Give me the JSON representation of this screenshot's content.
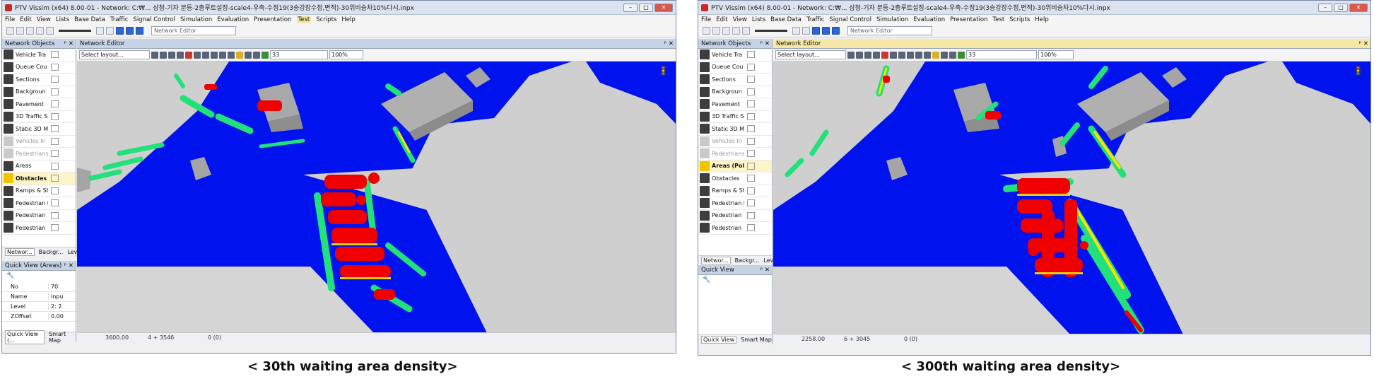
{
  "left_window": {
    "title": "PTV Vissim (x64) 8.00-01 - Network: C:₩... 상청-기자 분등-2층루트설정-scale4-우측-수정19(3승강장수정,면적)-30위비승차10%다시.inpx",
    "menu": [
      "File",
      "Edit",
      "View",
      "Lists",
      "Base Data",
      "Traffic",
      "Signal Control",
      "Simulation",
      "Evaluation",
      "Presentation",
      "Test",
      "Scripts",
      "Help"
    ],
    "network_editor_combo": "Network Editor",
    "network_objects_title": "Network Objects",
    "network_objects": [
      {
        "label": "Vehicle Tra",
        "state": "normal"
      },
      {
        "label": "Queue Cou",
        "state": "normal"
      },
      {
        "label": "Sections",
        "state": "normal"
      },
      {
        "label": "Backgroun",
        "state": "normal"
      },
      {
        "label": "Pavement",
        "state": "normal"
      },
      {
        "label": "3D Traffic S",
        "state": "normal"
      },
      {
        "label": "Static 3D M",
        "state": "normal"
      },
      {
        "label": "Vehicles In",
        "state": "dim"
      },
      {
        "label": "Pedestrians",
        "state": "dim"
      },
      {
        "label": "Areas",
        "state": "normal"
      },
      {
        "label": "Obstacles (",
        "state": "selected"
      },
      {
        "label": "Ramps & St",
        "state": "normal"
      },
      {
        "label": "Pedestrian I",
        "state": "normal"
      },
      {
        "label": "Pedestrian",
        "state": "normal"
      },
      {
        "label": "Pedestrian",
        "state": "normal"
      }
    ],
    "panel_tabs": [
      "Networ...",
      "Backgr...",
      "Levels"
    ],
    "quick_view_title": "Quick View (Areas)",
    "quick_view_rows": [
      {
        "key": "No",
        "value": "70"
      },
      {
        "key": "Name",
        "value": "inpu"
      },
      {
        "key": "Level",
        "value": "2: 2"
      },
      {
        "key": "ZOffset",
        "value": "0.00"
      }
    ],
    "quick_view_tabs": [
      "Quick View (...",
      "Smart Map"
    ],
    "editor_title": "Network Editor",
    "layout_placeholder": "Select layout...",
    "layout_value": "33",
    "zoom": "100%",
    "status": {
      "time": "3600.00",
      "coord": "4 + 3546",
      "count": "0 (0)"
    },
    "caption": "< 30th waiting area density>"
  },
  "right_window": {
    "title": "PTV Vissim (x64) 8.00-01 - Network: C:₩... 상청-기자 분등-2층루트설정-scale4-우측-수정19(3승강장수정,면적)-30위비승차10%다시.inpx",
    "menu": [
      "File",
      "Edit",
      "View",
      "Lists",
      "Base Data",
      "Traffic",
      "Signal Control",
      "Simulation",
      "Evaluation",
      "Presentation",
      "Test",
      "Scripts",
      "Help"
    ],
    "network_editor_combo": "Network Editor",
    "network_objects_title": "Network Objects",
    "network_objects": [
      {
        "label": "Vehicle Tra",
        "state": "normal"
      },
      {
        "label": "Queue Cou",
        "state": "normal"
      },
      {
        "label": "Sections",
        "state": "normal"
      },
      {
        "label": "Backgroun",
        "state": "normal"
      },
      {
        "label": "Pavement",
        "state": "normal"
      },
      {
        "label": "3D Traffic S",
        "state": "normal"
      },
      {
        "label": "Static 3D M",
        "state": "normal"
      },
      {
        "label": "Vehicles In",
        "state": "dim"
      },
      {
        "label": "Pedestrians",
        "state": "dim"
      },
      {
        "label": "Areas (Pol",
        "state": "selected"
      },
      {
        "label": "Obstacles",
        "state": "normal"
      },
      {
        "label": "Ramps & St",
        "state": "normal"
      },
      {
        "label": "Pedestrian I",
        "state": "normal"
      },
      {
        "label": "Pedestrian",
        "state": "normal"
      },
      {
        "label": "Pedestrian",
        "state": "normal"
      }
    ],
    "panel_tabs": [
      "Networ...",
      "Backgr...",
      "Levels"
    ],
    "quick_view_title": "Quick View",
    "quick_view_tabs": [
      "Quick View",
      "Smart Map"
    ],
    "editor_title": "Network Editor",
    "layout_placeholder": "Select layout...",
    "layout_value": "33",
    "zoom": "100%",
    "status": {
      "time": "2258.00",
      "coord": "6 + 3045",
      "count": "0 (0)"
    },
    "caption": "< 300th  waiting area density>"
  },
  "colors": {
    "floor": "#0010f0",
    "background": "#cfcfcf",
    "hot": "#f00000",
    "warm": "#ffe000",
    "mid": "#22e07a",
    "cool": "#10c8ff"
  }
}
